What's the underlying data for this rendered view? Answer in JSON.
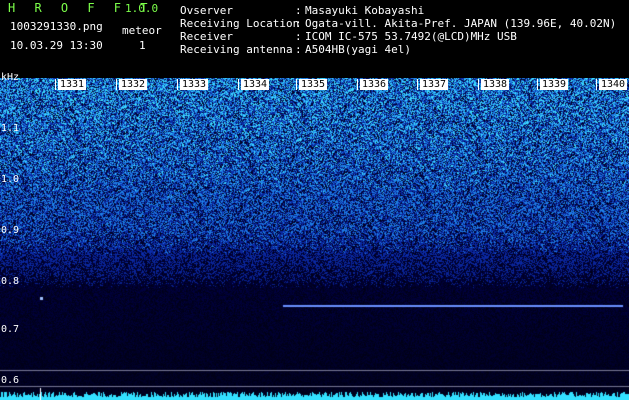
{
  "header": {
    "app_title": "H R O F F T",
    "app_version": "1.0.0",
    "filename": "1003291330.png",
    "timestamp": "10.03.29 13:30",
    "meteor_label": "meteor",
    "meteor_count": "1",
    "info": [
      {
        "key": "Ovserver",
        "value": "Masayuki Kobayashi"
      },
      {
        "key": "Receiving Location",
        "value": "Ogata-vill. Akita-Pref. JAPAN (139.96E, 40.02N)"
      },
      {
        "key": "Receiver",
        "value": "ICOM IC-575 53.7492(@LCD)MHz USB"
      },
      {
        "key": "Receiving antenna",
        "value": "A504HB(yagi 4el)"
      }
    ]
  },
  "spectrogram": {
    "y_unit": "kHz",
    "y_ticks": [
      "1.1",
      "1.0",
      "0.9",
      "0.8",
      "0.7",
      "0.6"
    ],
    "x_ticks": [
      "1331",
      "1332",
      "1333",
      "1334",
      "1335",
      "1336",
      "1337",
      "1338",
      "1339",
      "1340"
    ],
    "colors": {
      "background": "#000000",
      "noise_low": "#0a1a66",
      "noise_high": "#3aa0ff",
      "trace": "#7aa0ff",
      "amplitude": "#33e0ff"
    }
  }
}
